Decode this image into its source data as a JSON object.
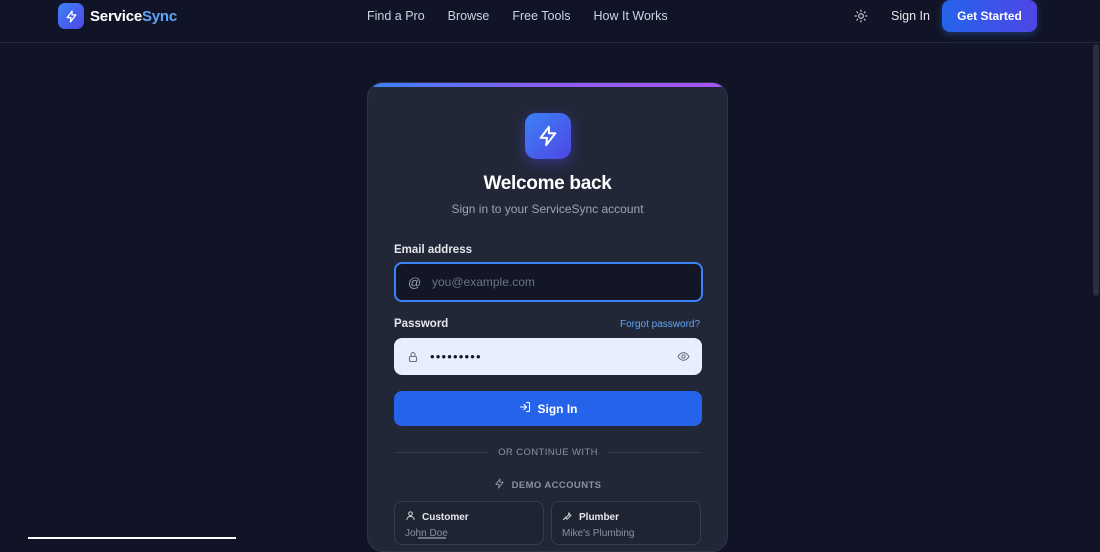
{
  "brand": {
    "name_part1": "Service",
    "name_part2": "Sync",
    "logo_icon": "bolt-icon"
  },
  "nav": {
    "links": [
      "Find a Pro",
      "Browse",
      "Free Tools",
      "How It Works"
    ],
    "theme_icon": "sun-icon",
    "sign_in": "Sign In",
    "get_started": "Get Started"
  },
  "login": {
    "title": "Welcome back",
    "subtitle": "Sign in to your ServiceSync account",
    "email_label": "Email address",
    "email_placeholder": "you@example.com",
    "email_icon": "@",
    "password_label": "Password",
    "forgot_password": "Forgot password?",
    "password_value": "•••••••••",
    "sign_in_button": "Sign In",
    "divider_text": "OR CONTINUE WITH",
    "demo_label": "DEMO ACCOUNTS",
    "demo_accounts": [
      {
        "role": "Customer",
        "name": "John Doe",
        "icon": "user-icon"
      },
      {
        "role": "Plumber",
        "name": "Mike's Plumbing",
        "icon": "wrench-icon"
      }
    ]
  },
  "colors": {
    "background": "#111426",
    "card": "#222737",
    "accent": "#2563eb",
    "link": "#60a5fa"
  }
}
